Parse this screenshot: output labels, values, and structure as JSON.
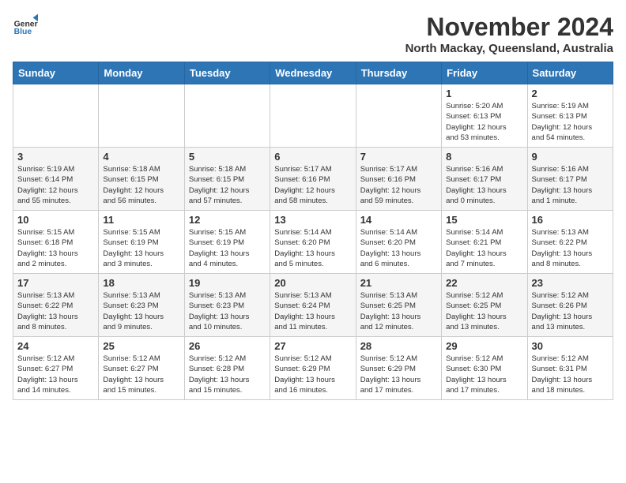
{
  "header": {
    "logo_line1": "General",
    "logo_line2": "Blue",
    "month": "November 2024",
    "location": "North Mackay, Queensland, Australia"
  },
  "weekdays": [
    "Sunday",
    "Monday",
    "Tuesday",
    "Wednesday",
    "Thursday",
    "Friday",
    "Saturday"
  ],
  "weeks": [
    [
      {
        "day": "",
        "info": ""
      },
      {
        "day": "",
        "info": ""
      },
      {
        "day": "",
        "info": ""
      },
      {
        "day": "",
        "info": ""
      },
      {
        "day": "",
        "info": ""
      },
      {
        "day": "1",
        "info": "Sunrise: 5:20 AM\nSunset: 6:13 PM\nDaylight: 12 hours\nand 53 minutes."
      },
      {
        "day": "2",
        "info": "Sunrise: 5:19 AM\nSunset: 6:13 PM\nDaylight: 12 hours\nand 54 minutes."
      }
    ],
    [
      {
        "day": "3",
        "info": "Sunrise: 5:19 AM\nSunset: 6:14 PM\nDaylight: 12 hours\nand 55 minutes."
      },
      {
        "day": "4",
        "info": "Sunrise: 5:18 AM\nSunset: 6:15 PM\nDaylight: 12 hours\nand 56 minutes."
      },
      {
        "day": "5",
        "info": "Sunrise: 5:18 AM\nSunset: 6:15 PM\nDaylight: 12 hours\nand 57 minutes."
      },
      {
        "day": "6",
        "info": "Sunrise: 5:17 AM\nSunset: 6:16 PM\nDaylight: 12 hours\nand 58 minutes."
      },
      {
        "day": "7",
        "info": "Sunrise: 5:17 AM\nSunset: 6:16 PM\nDaylight: 12 hours\nand 59 minutes."
      },
      {
        "day": "8",
        "info": "Sunrise: 5:16 AM\nSunset: 6:17 PM\nDaylight: 13 hours\nand 0 minutes."
      },
      {
        "day": "9",
        "info": "Sunrise: 5:16 AM\nSunset: 6:17 PM\nDaylight: 13 hours\nand 1 minute."
      }
    ],
    [
      {
        "day": "10",
        "info": "Sunrise: 5:15 AM\nSunset: 6:18 PM\nDaylight: 13 hours\nand 2 minutes."
      },
      {
        "day": "11",
        "info": "Sunrise: 5:15 AM\nSunset: 6:19 PM\nDaylight: 13 hours\nand 3 minutes."
      },
      {
        "day": "12",
        "info": "Sunrise: 5:15 AM\nSunset: 6:19 PM\nDaylight: 13 hours\nand 4 minutes."
      },
      {
        "day": "13",
        "info": "Sunrise: 5:14 AM\nSunset: 6:20 PM\nDaylight: 13 hours\nand 5 minutes."
      },
      {
        "day": "14",
        "info": "Sunrise: 5:14 AM\nSunset: 6:20 PM\nDaylight: 13 hours\nand 6 minutes."
      },
      {
        "day": "15",
        "info": "Sunrise: 5:14 AM\nSunset: 6:21 PM\nDaylight: 13 hours\nand 7 minutes."
      },
      {
        "day": "16",
        "info": "Sunrise: 5:13 AM\nSunset: 6:22 PM\nDaylight: 13 hours\nand 8 minutes."
      }
    ],
    [
      {
        "day": "17",
        "info": "Sunrise: 5:13 AM\nSunset: 6:22 PM\nDaylight: 13 hours\nand 8 minutes."
      },
      {
        "day": "18",
        "info": "Sunrise: 5:13 AM\nSunset: 6:23 PM\nDaylight: 13 hours\nand 9 minutes."
      },
      {
        "day": "19",
        "info": "Sunrise: 5:13 AM\nSunset: 6:23 PM\nDaylight: 13 hours\nand 10 minutes."
      },
      {
        "day": "20",
        "info": "Sunrise: 5:13 AM\nSunset: 6:24 PM\nDaylight: 13 hours\nand 11 minutes."
      },
      {
        "day": "21",
        "info": "Sunrise: 5:13 AM\nSunset: 6:25 PM\nDaylight: 13 hours\nand 12 minutes."
      },
      {
        "day": "22",
        "info": "Sunrise: 5:12 AM\nSunset: 6:25 PM\nDaylight: 13 hours\nand 13 minutes."
      },
      {
        "day": "23",
        "info": "Sunrise: 5:12 AM\nSunset: 6:26 PM\nDaylight: 13 hours\nand 13 minutes."
      }
    ],
    [
      {
        "day": "24",
        "info": "Sunrise: 5:12 AM\nSunset: 6:27 PM\nDaylight: 13 hours\nand 14 minutes."
      },
      {
        "day": "25",
        "info": "Sunrise: 5:12 AM\nSunset: 6:27 PM\nDaylight: 13 hours\nand 15 minutes."
      },
      {
        "day": "26",
        "info": "Sunrise: 5:12 AM\nSunset: 6:28 PM\nDaylight: 13 hours\nand 15 minutes."
      },
      {
        "day": "27",
        "info": "Sunrise: 5:12 AM\nSunset: 6:29 PM\nDaylight: 13 hours\nand 16 minutes."
      },
      {
        "day": "28",
        "info": "Sunrise: 5:12 AM\nSunset: 6:29 PM\nDaylight: 13 hours\nand 17 minutes."
      },
      {
        "day": "29",
        "info": "Sunrise: 5:12 AM\nSunset: 6:30 PM\nDaylight: 13 hours\nand 17 minutes."
      },
      {
        "day": "30",
        "info": "Sunrise: 5:12 AM\nSunset: 6:31 PM\nDaylight: 13 hours\nand 18 minutes."
      }
    ]
  ]
}
